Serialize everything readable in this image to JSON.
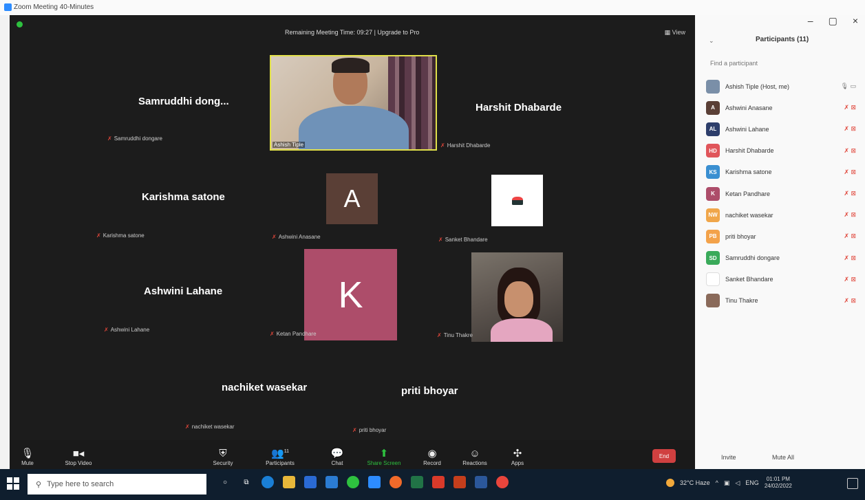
{
  "window": {
    "title": "Zoom Meeting 40-Minutes",
    "controls": [
      "–",
      "▢",
      "×"
    ]
  },
  "meeting": {
    "timer_text": "Remaining Meeting Time: 09:27 | Upgrade to Pro",
    "view_label": "View",
    "tiles": [
      {
        "name": "Samruddhi dong...",
        "label": "Samruddhi dongare"
      },
      {
        "name": "Harshit Dhabarde",
        "label": "Harshit Dhabarde"
      },
      {
        "name": "Karishma satone",
        "label": "Karishma satone"
      },
      {
        "name": "",
        "label": "Ashwini Anasane",
        "initial": "A"
      },
      {
        "name": "",
        "label": "Sanket Bhandare"
      },
      {
        "name": "Ashwini Lahane",
        "label": "Ashwini Lahane"
      },
      {
        "name": "",
        "label": "Ketan Pandhare",
        "initial": "K"
      },
      {
        "name": "",
        "label": "Tinu Thakre"
      },
      {
        "name": "nachiket wasekar",
        "label": "nachiket wasekar"
      },
      {
        "name": "priti bhoyar",
        "label": "priti bhoyar"
      }
    ],
    "host_video_label": "Ashish Tiple"
  },
  "toolbar": {
    "mute": "Mute",
    "stop_video": "Stop Video",
    "security": "Security",
    "participants": "Participants",
    "participants_count": "11",
    "chat": "Chat",
    "share_screen": "Share Screen",
    "record": "Record",
    "reactions": "Reactions",
    "apps": "Apps",
    "end": "End"
  },
  "panel": {
    "title": "Participants (11)",
    "search_placeholder": "Find a participant",
    "participants": [
      {
        "name": "Ashish Tiple (Host, me)",
        "initials": "",
        "color": "#7a8fa8"
      },
      {
        "name": "Ashwini Anasane",
        "initials": "A",
        "color": "#5a3f36"
      },
      {
        "name": "Ashwini Lahane",
        "initials": "AL",
        "color": "#2d3e6b"
      },
      {
        "name": "Harshit Dhabarde",
        "initials": "HD",
        "color": "#e0555a"
      },
      {
        "name": "Karishma satone",
        "initials": "KS",
        "color": "#3a8fd1"
      },
      {
        "name": "Ketan Pandhare",
        "initials": "K",
        "color": "#ad4d6a"
      },
      {
        "name": "nachiket wasekar",
        "initials": "NW",
        "color": "#f0a64a"
      },
      {
        "name": "priti bhoyar",
        "initials": "PB",
        "color": "#f3a24a"
      },
      {
        "name": "Samruddhi dongare",
        "initials": "SD",
        "color": "#3aaa5a"
      },
      {
        "name": "Sanket Bhandare",
        "initials": "",
        "color": "#ffffff"
      },
      {
        "name": "Tinu Thakre",
        "initials": "",
        "color": "#8a6a5a"
      }
    ],
    "invite": "Invite",
    "mute_all": "Mute All"
  },
  "taskbar": {
    "search_placeholder": "Type here to search",
    "weather": "32°C  Haze",
    "language": "ENG",
    "time": "01:01 PM",
    "date": "24/02/2022"
  }
}
